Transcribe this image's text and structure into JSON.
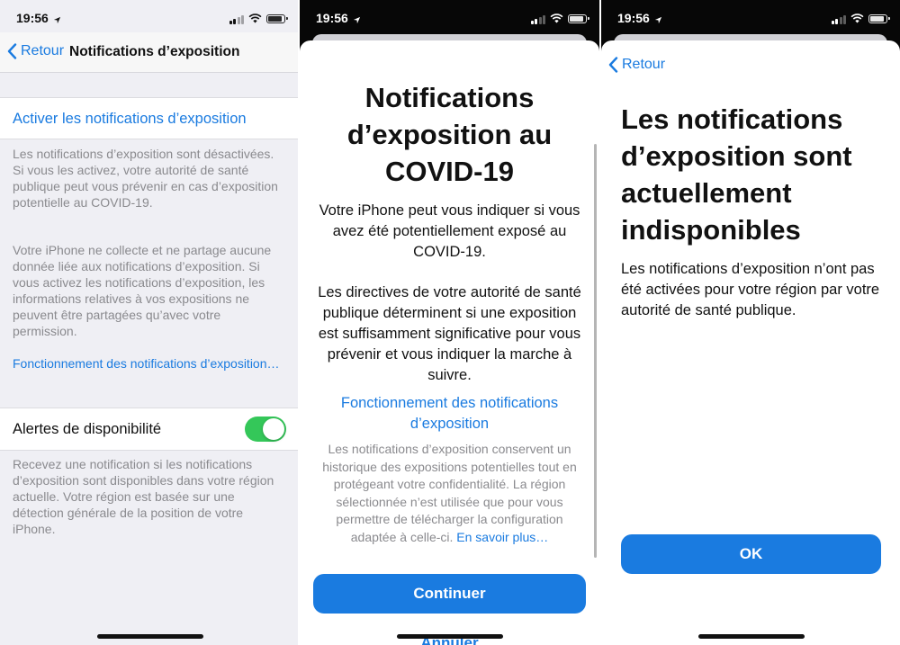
{
  "screens": [
    {
      "status": {
        "time": "19:56"
      },
      "nav": {
        "back_label": "Retour",
        "title": "Notifications d’exposition"
      },
      "activate_label": "Activer les notifications d’exposition",
      "footer1": "Les notifications d’exposition sont désactivées. Si vous les activez, votre autorité de santé publique peut vous prévenir en cas d’exposition potentielle au COVID-19.",
      "footer2": "Votre iPhone ne collecte et ne partage aucune donnée liée aux notifications d’exposition. Si vous activez les notifications d’exposition, les informations relatives à vos expositions ne peuvent être partagées qu’avec votre permission.",
      "link": "Fonctionnement des notifications d’exposition…",
      "alerts_label": "Alertes de disponibilité",
      "alerts_enabled": true,
      "footer3": "Recevez une notification si les notifications d’exposition sont disponibles dans votre région actuelle. Votre région est basée sur une détection générale de la position de votre iPhone."
    },
    {
      "status": {
        "time": "19:56"
      },
      "title": "Notifications d’exposition au COVID-19",
      "para1": "Votre iPhone peut vous indiquer si vous avez été potentiellement exposé au COVID-19.",
      "para2": "Les directives de votre autorité de santé publique déterminent si une exposition est suffisamment significative pour vous prévenir et vous indiquer la marche à suivre.",
      "link": "Fonctionnement des notifications d’exposition",
      "privacy": "Les notifications d’exposition conservent un historique des expositions potentielles tout en protégeant votre confidentialité. La région sélectionnée n’est utilisée que pour vous permettre de télécharger la configuration adaptée à celle-ci.",
      "learn_more": "En savoir plus…",
      "continue_label": "Continuer",
      "cancel_label": "Annuler"
    },
    {
      "status": {
        "time": "19:56"
      },
      "back_label": "Retour",
      "title": "Les notifications d’exposition sont actuellement indisponibles",
      "body": "Les notifications d’exposition n’ont pas été activées pour votre région par votre autorité de santé publique.",
      "ok_label": "OK"
    }
  ],
  "colors": {
    "accent": "#1a7be0",
    "toggle_on": "#34c759",
    "grey_text": "#8a8a8e"
  }
}
